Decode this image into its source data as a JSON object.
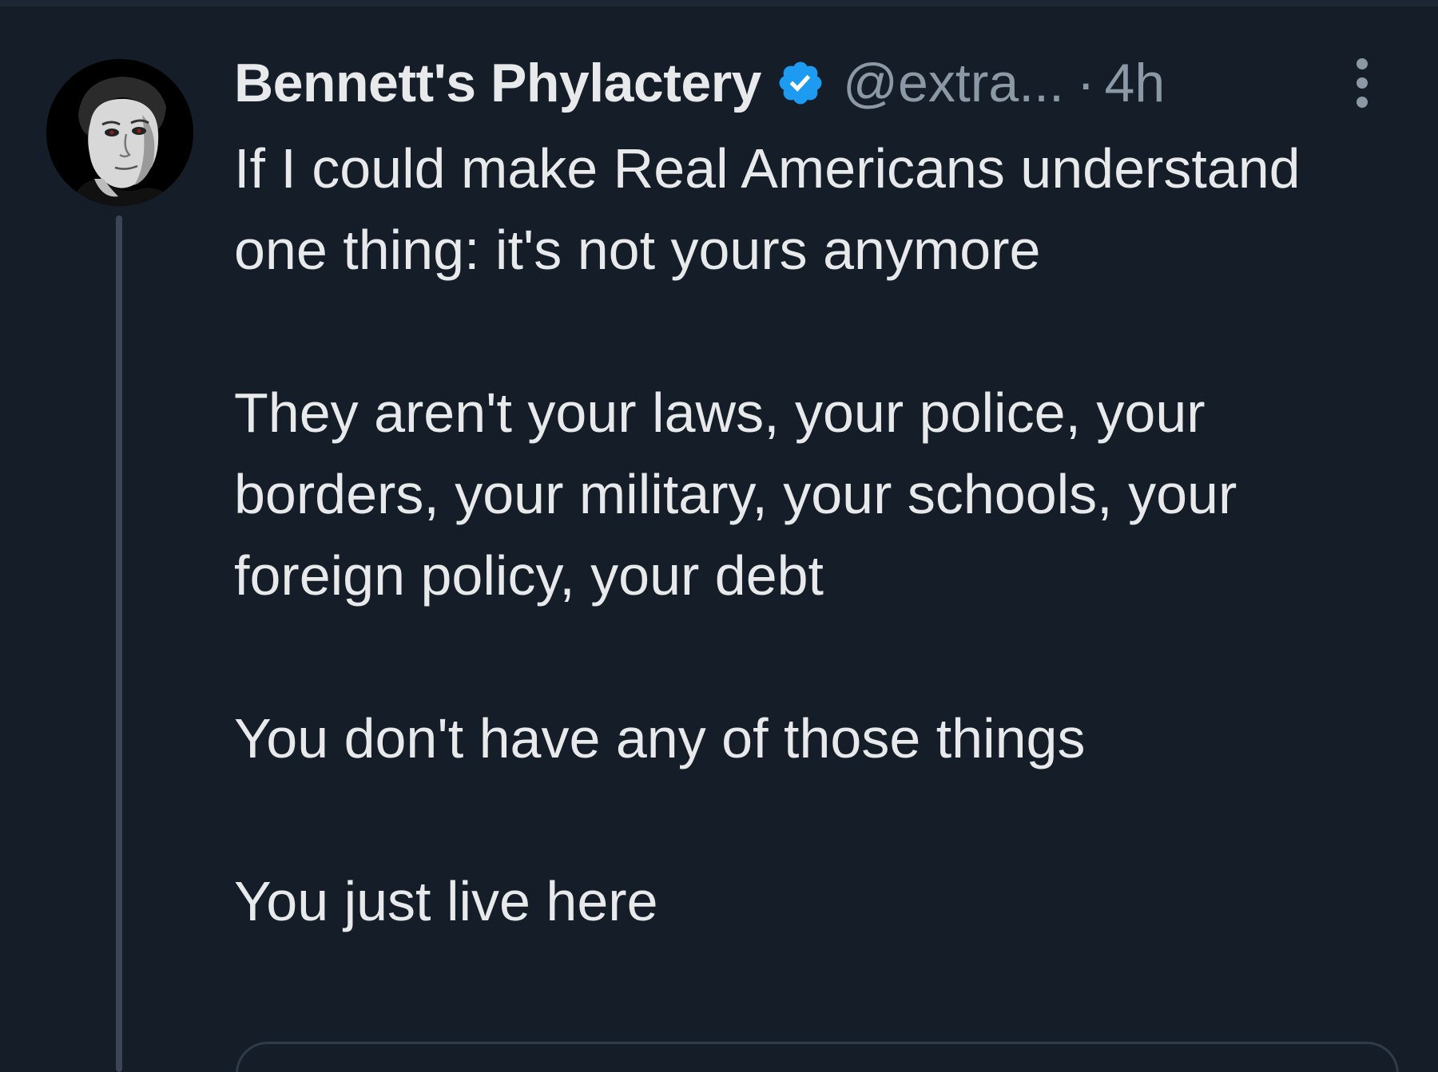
{
  "tweet": {
    "author": {
      "display_name": "Bennett's Phylactery",
      "handle": "@extra...",
      "verified": true,
      "avatar": "portrait-avatar"
    },
    "separator": "·",
    "time": "4h",
    "paragraphs": [
      "If I could make Real Americans understand one thing: it's not yours anymore",
      "They aren't your laws, your police, your borders, your military, your schools, your foreign policy, your debt",
      "You don't have any of those things",
      "You just live here"
    ],
    "icons": {
      "verified": "verified-badge-icon",
      "more": "more-vertical-icon"
    },
    "colors": {
      "background": "#151d28",
      "text": "#e7e9ea",
      "secondary_text": "#8b98a5",
      "verified_blue": "#1d9bf0",
      "thread_line": "#3a4654"
    }
  }
}
